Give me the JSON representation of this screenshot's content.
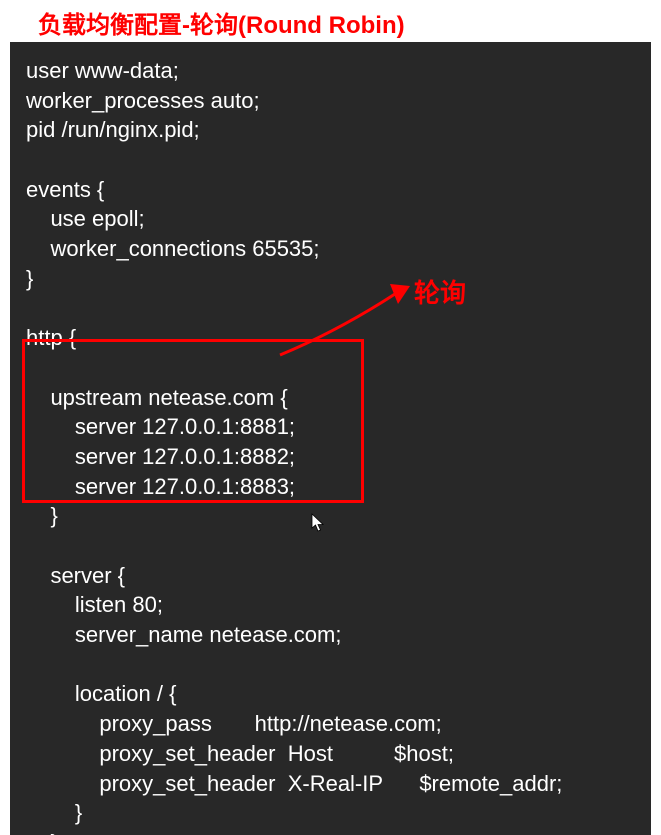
{
  "title": "负载均衡配置-轮询(Round Robin)",
  "annotation": {
    "label": "轮询"
  },
  "code": {
    "lines": [
      "user www-data;",
      "worker_processes auto;",
      "pid /run/nginx.pid;",
      "",
      "events {",
      "    use epoll;",
      "    worker_connections 65535;",
      "}",
      "",
      "http {",
      "",
      "    upstream netease.com {",
      "        server 127.0.0.1:8881;",
      "        server 127.0.0.1:8882;",
      "        server 127.0.0.1:8883;",
      "    }",
      "",
      "    server {",
      "        listen 80;",
      "        server_name netease.com;",
      "",
      "        location / {",
      "            proxy_pass       http://netease.com;",
      "            proxy_set_header  Host          $host;",
      "            proxy_set_header  X-Real-IP      $remote_addr;",
      "        }",
      "    }",
      "}"
    ]
  }
}
